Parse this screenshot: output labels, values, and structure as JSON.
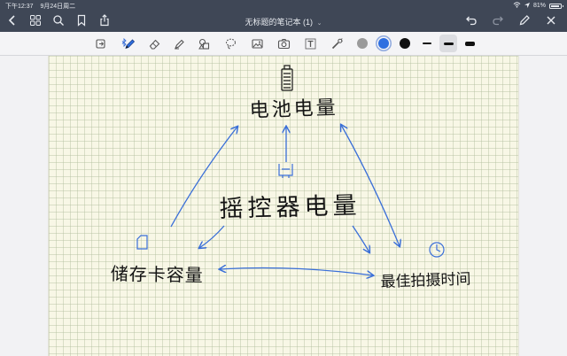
{
  "status_bar": {
    "time": "下午12:37",
    "date": "9月24日周二",
    "battery_percent": "81%"
  },
  "navbar": {
    "title": "无标题的笔记本 (1)",
    "title_chevron": "⌄",
    "left_icons": [
      "back-chevron-icon",
      "grid-icon",
      "search-icon",
      "bookmark-icon",
      "share-icon"
    ],
    "right_icons": [
      "undo-icon",
      "redo-icon",
      "pencil-icon",
      "close-icon"
    ]
  },
  "toolbar": {
    "tools": [
      "read-mode-icon",
      "pen-icon",
      "eraser-icon",
      "highlighter-icon",
      "shapes-icon",
      "lasso-icon",
      "image-icon",
      "camera-icon",
      "text-icon",
      "laser-pointer-icon"
    ],
    "selected_tool": "pen-icon",
    "colors": [
      "#9a9a9a",
      "#2f6fe0",
      "#111111"
    ],
    "selected_color": "#2f6fe0",
    "stroke_widths": [
      "thin",
      "medium",
      "thick"
    ],
    "selected_stroke": "medium"
  },
  "canvas": {
    "paper_color": "#f8f7e6",
    "ink_black": "#151515",
    "ink_blue": "#3a6fd8",
    "labels": {
      "battery": "电池电量",
      "remote": "摇控器电量",
      "storage": "储存卡容量",
      "time": "最佳拍摄时间"
    }
  }
}
